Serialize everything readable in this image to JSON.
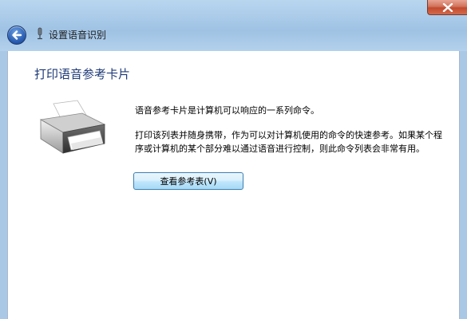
{
  "window": {
    "close_icon": "close-icon"
  },
  "navigation": {
    "back_icon": "back-arrow-icon",
    "breadcrumb_icon": "microphone-icon",
    "breadcrumb": "设置语音识别"
  },
  "content": {
    "heading": "打印语音参考卡片",
    "illustration_icon": "printer-icon",
    "paragraph1": "语音参考卡片是计算机可以响应的一系列命令。",
    "paragraph2": "打印该列表并随身携带，作为可以对计算机使用的命令的快速参考。如果某个程序或计算机的某个部分难以通过语音进行控制，则此命令列表会非常有用。",
    "view_button_label": "查看参考表(V)"
  },
  "colors": {
    "heading": "#1e3a78",
    "titlebar": "#a8c9e8",
    "close_button": "#c24a2e",
    "button_border": "#3c7fb1"
  }
}
